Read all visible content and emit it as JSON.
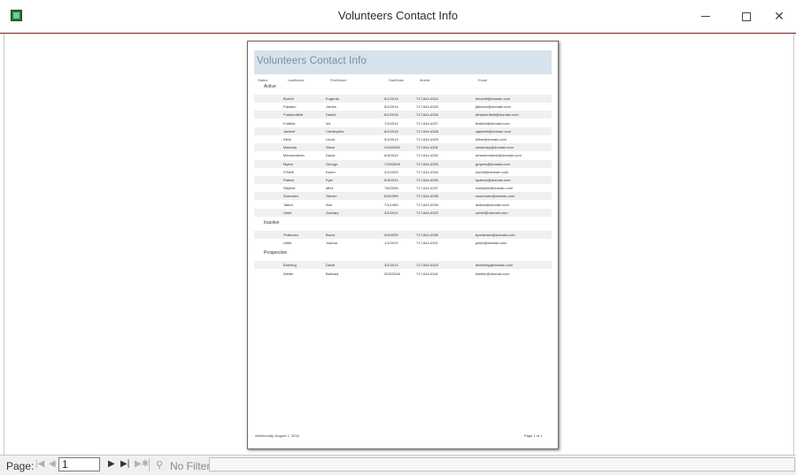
{
  "window": {
    "title": "Volunteers Contact Info"
  },
  "report": {
    "title": "Volunteers Contact Info",
    "columns": [
      "Status",
      "LastName",
      "FirstName",
      "StartDate",
      "Mobile",
      "Email"
    ],
    "groups": [
      {
        "label": "Active",
        "rows": [
          [
            "Burrell",
            "Eugenia",
            "6/1/2013",
            "717-644-4324",
            "eburrell@domain.com"
          ],
          [
            "Fabiano",
            "James",
            "5/1/2014",
            "717-644-4325",
            "jfabiano@domain.com"
          ],
          [
            "Frankenfield",
            "Daniel",
            "6/1/2015",
            "717-644-4326",
            "dfrankenfield@domain.com"
          ],
          [
            "Fraifeld",
            "Iris",
            "7/1/2014",
            "717-644-4327",
            "ifraifeld@domain.com"
          ],
          [
            "Jaubert",
            "Christopher",
            "6/1/2015",
            "717-644-4328",
            "cjaubert@domain.com"
          ],
          [
            "Kline",
            "Linda",
            "9/1/2013",
            "717-644-4329",
            "lkline@domain.com"
          ],
          [
            "Maloney",
            "Steve",
            "2/15/2000",
            "717-644-4331",
            "smaloney@domain.com"
          ],
          [
            "Mammolstein",
            "David",
            "6/3/2010",
            "717-644-4332",
            "dmammolstein@domain.com"
          ],
          [
            "Myers",
            "George",
            "7/23/2009",
            "717-644-4333",
            "gmyers@domain.com"
          ],
          [
            "O'Neill",
            "Karen",
            "2/1/2003",
            "717-644-4334",
            "koneill@domain.com"
          ],
          [
            "Patrick",
            "Kyle",
            "6/3/2010",
            "717-644-4335",
            "kpatrick@domain.com"
          ],
          [
            "Stephie",
            "Mimi",
            "7/6/2008",
            "717-644-4337",
            "mstephie@domain.com"
          ],
          [
            "Sorensen",
            "Steven",
            "6/9/1999",
            "717-644-4338",
            "ssorensen@domain.com"
          ],
          [
            "Talbot",
            "Ann",
            "7/1/1989",
            "717-644-4339",
            "atalbot@domain.com"
          ],
          [
            "Uhlet",
            "Zachary",
            "3/1/2011",
            "717-644-4322",
            "zuhlet@domain.com"
          ]
        ]
      },
      {
        "label": "Inactive",
        "rows": [
          [
            "Pedersen",
            "Bruce",
            "5/9/2009",
            "717-644-4336",
            "bpedersen@domain.com"
          ],
          [
            "Uhlet",
            "Joshua",
            "1/1/2010",
            "717-644-4321",
            "juhlet@domain.com"
          ]
        ]
      },
      {
        "label": "Prospective",
        "rows": [
          [
            "Eberling",
            "David",
            "3/1/2013",
            "717-644-4323",
            "deberling@domain.com"
          ],
          [
            "Weller",
            "Barbara",
            "3/25/2006",
            "717-644-4341",
            "bweller@domain.com"
          ]
        ]
      }
    ],
    "footer": {
      "date": "Wednesday, August 1, 2018",
      "page": "Page 1 of 1"
    }
  },
  "navigation": {
    "page_label": "Page:",
    "current_page": "1",
    "filter_label": "No Filter",
    "icons": [
      "first-page-icon",
      "previous-page-icon",
      "next-page-icon",
      "last-page-icon",
      "new-page-icon",
      "filter-icon"
    ]
  },
  "colors": {
    "header_band": "#d6e3ee",
    "title_text": "#7a8d9c",
    "window_border": "#7f1f1f",
    "row_shade": "#f0f0f0"
  }
}
